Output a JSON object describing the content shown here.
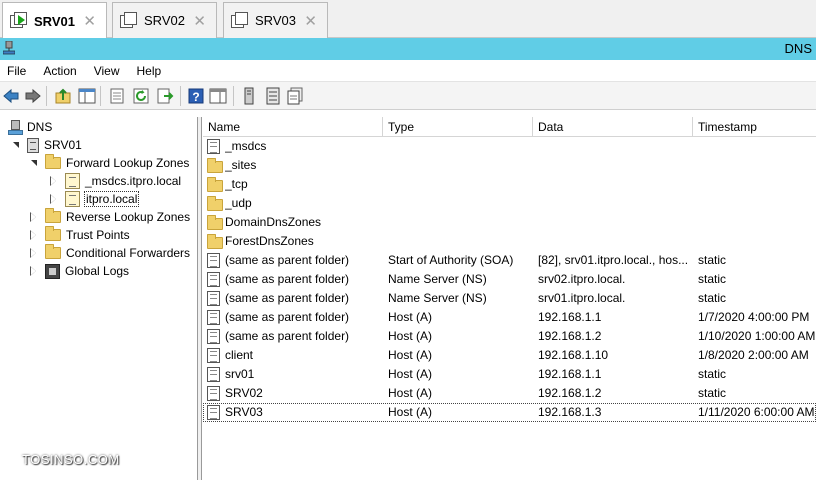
{
  "tabs": [
    {
      "label": "SRV01"
    },
    {
      "label": "SRV02"
    },
    {
      "label": "SRV03"
    }
  ],
  "window": {
    "title": "DNS"
  },
  "menu": [
    "File",
    "Action",
    "View",
    "Help"
  ],
  "tree": {
    "root": "DNS",
    "server": "SRV01",
    "forward": "Forward Lookup Zones",
    "zone_msdcs": "_msdcs.itpro.local",
    "zone_itpro": "itpro.local",
    "reverse": "Reverse Lookup Zones",
    "trust": "Trust Points",
    "conditional": "Conditional Forwarders",
    "logs": "Global Logs"
  },
  "columns": [
    "Name",
    "Type",
    "Data",
    "Timestamp"
  ],
  "rows": [
    {
      "icon": "record",
      "name": "_msdcs",
      "type": "",
      "data": "",
      "timestamp": ""
    },
    {
      "icon": "folder",
      "name": "_sites",
      "type": "",
      "data": "",
      "timestamp": ""
    },
    {
      "icon": "folder",
      "name": "_tcp",
      "type": "",
      "data": "",
      "timestamp": ""
    },
    {
      "icon": "folder",
      "name": "_udp",
      "type": "",
      "data": "",
      "timestamp": ""
    },
    {
      "icon": "folder",
      "name": "DomainDnsZones",
      "type": "",
      "data": "",
      "timestamp": ""
    },
    {
      "icon": "folder",
      "name": "ForestDnsZones",
      "type": "",
      "data": "",
      "timestamp": ""
    },
    {
      "icon": "record",
      "name": "(same as parent folder)",
      "type": "Start of Authority (SOA)",
      "data": "[82], srv01.itpro.local., hos...",
      "timestamp": "static"
    },
    {
      "icon": "record",
      "name": "(same as parent folder)",
      "type": "Name Server (NS)",
      "data": "srv02.itpro.local.",
      "timestamp": "static"
    },
    {
      "icon": "record",
      "name": "(same as parent folder)",
      "type": "Name Server (NS)",
      "data": "srv01.itpro.local.",
      "timestamp": "static"
    },
    {
      "icon": "record",
      "name": "(same as parent folder)",
      "type": "Host (A)",
      "data": "192.168.1.1",
      "timestamp": "1/7/2020 4:00:00 PM"
    },
    {
      "icon": "record",
      "name": "(same as parent folder)",
      "type": "Host (A)",
      "data": "192.168.1.2",
      "timestamp": "1/10/2020 1:00:00 AM"
    },
    {
      "icon": "record",
      "name": "client",
      "type": "Host (A)",
      "data": "192.168.1.10",
      "timestamp": "1/8/2020 2:00:00 AM"
    },
    {
      "icon": "record",
      "name": "srv01",
      "type": "Host (A)",
      "data": "192.168.1.1",
      "timestamp": "static"
    },
    {
      "icon": "record",
      "name": "SRV02",
      "type": "Host (A)",
      "data": "192.168.1.2",
      "timestamp": "static"
    },
    {
      "icon": "record",
      "name": "SRV03",
      "type": "Host (A)",
      "data": "192.168.1.3",
      "timestamp": "1/11/2020 6:00:00 AM"
    }
  ],
  "watermark": "TOSINSO.COM",
  "colors": {
    "titlebar": "#60cde6",
    "folder": "#f0d06a"
  }
}
